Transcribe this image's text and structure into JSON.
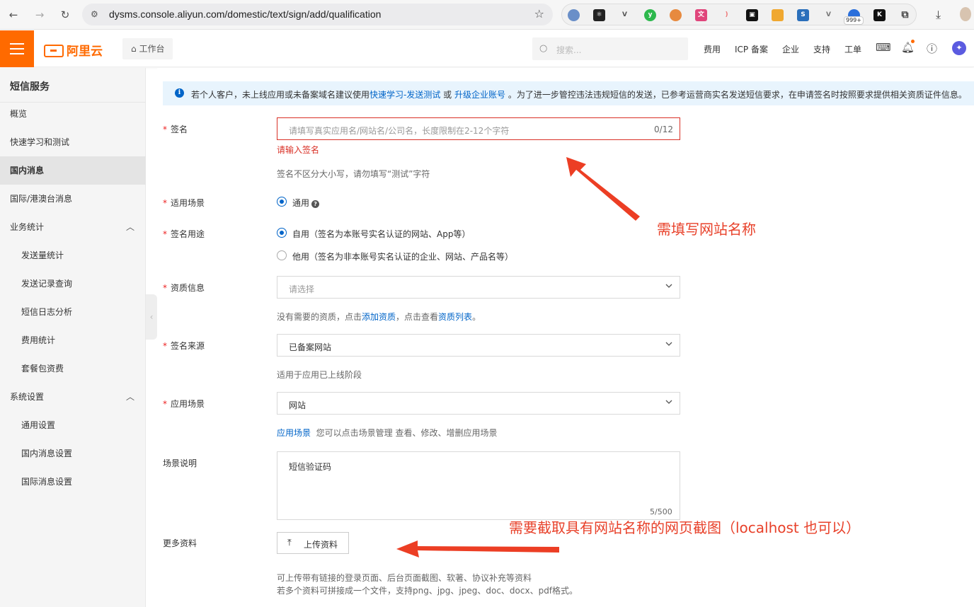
{
  "browser": {
    "url": "dysms.console.aliyun.com/domestic/text/sign/add/qualification",
    "ext_badge": "999+"
  },
  "topnav": {
    "logo_text": "阿里云",
    "workbench_label": "工作台",
    "search_placeholder": "搜索...",
    "items": [
      "费用",
      "ICP 备案",
      "企业",
      "支持",
      "工单"
    ]
  },
  "sidebar": {
    "title": "短信服务",
    "items": [
      {
        "label": "概览"
      },
      {
        "label": "快速学习和测试"
      },
      {
        "label": "国内消息",
        "active": true
      },
      {
        "label": "国际/港澳台消息"
      },
      {
        "label": "业务统计",
        "expanded": true
      },
      {
        "label": "发送量统计",
        "sub": true
      },
      {
        "label": "发送记录查询",
        "sub": true
      },
      {
        "label": "短信日志分析",
        "sub": true
      },
      {
        "label": "费用统计",
        "sub": true
      },
      {
        "label": "套餐包资费",
        "sub": true
      },
      {
        "label": "系统设置",
        "expanded": true
      },
      {
        "label": "通用设置",
        "sub": true
      },
      {
        "label": "国内消息设置",
        "sub": true
      },
      {
        "label": "国际消息设置",
        "sub": true
      }
    ]
  },
  "notice": {
    "text_before": "若个人客户，未上线应用或未备案域名建议使用",
    "link1": "快速学习-发送测试",
    "text_or": " 或 ",
    "link2": "升级企业账号",
    "text_after": " 。为了进一步管控违法违规短信的发送，已参考运营商实名发送短信要求，在申请签名时按照要求提供相关资质证件信息。"
  },
  "form": {
    "sign": {
      "label": "签名",
      "placeholder": "请填写真实应用名/网站名/公司名，长度限制在2-12个字符",
      "count": "0/12",
      "error": "请输入签名",
      "hint": "签名不区分大小写，请勿填写“测试”字符"
    },
    "scene": {
      "label": "适用场景",
      "option": "通用"
    },
    "purpose": {
      "label": "签名用途",
      "option1": "自用（签名为本账号实名认证的网站、App等）",
      "option2": "他用（签名为非本账号实名认证的企业、网站、产品名等）"
    },
    "qualification": {
      "label": "资质信息",
      "placeholder": "请选择",
      "hint_before": "没有需要的资质，点击",
      "hint_link1": "添加资质",
      "hint_mid": "，点击查看",
      "hint_link2": "资质列表",
      "hint_end": "。"
    },
    "source": {
      "label": "签名来源",
      "value": "已备案网站",
      "hint": "适用于应用已上线阶段"
    },
    "app_scene": {
      "label": "应用场景",
      "value": "网站",
      "hint_link": "应用场景",
      "hint_text": "您可以点击场景管理 查看、修改、增删应用场景"
    },
    "scene_desc": {
      "label": "场景说明",
      "value": "短信验证码",
      "count": "5/500"
    },
    "more": {
      "label": "更多资料",
      "button": "上传资料",
      "hint1": "可上传带有链接的登录页面、后台页面截图、软著、协议补充等资料",
      "hint2": "若多个资料可拼接成一个文件，支持png、jpg、jpeg、doc、docx、pdf格式。"
    }
  },
  "annotations": {
    "a1": "需填写网站名称",
    "a2": "需要截取具有网站名称的网页截图（localhost 也可以）"
  },
  "colors": {
    "brand": "#ff6a00",
    "link": "#0064c8",
    "error": "#d93026",
    "annotation": "#e8412a"
  }
}
